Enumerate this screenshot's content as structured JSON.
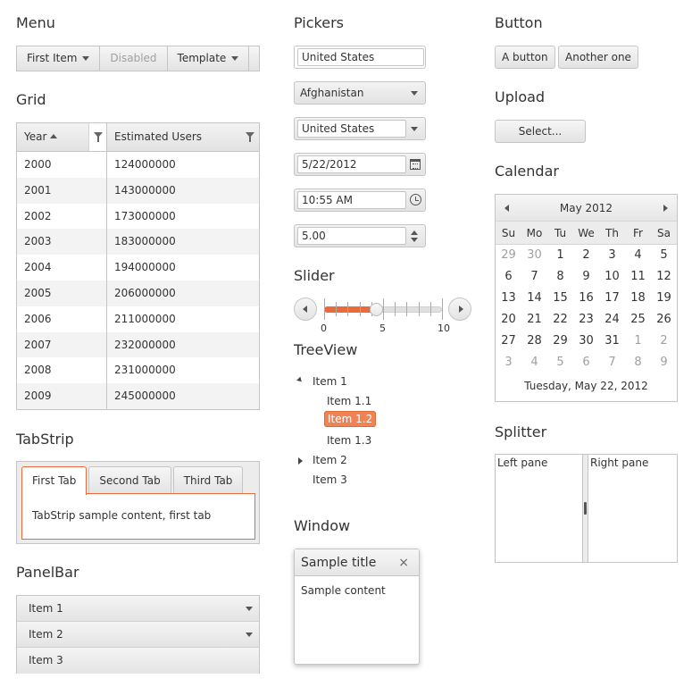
{
  "headings": {
    "menu": "Menu",
    "grid": "Grid",
    "tabstrip": "TabStrip",
    "panelbar": "PanelBar",
    "pickers": "Pickers",
    "slider": "Slider",
    "treeview": "TreeView",
    "window": "Window",
    "button": "Button",
    "upload": "Upload",
    "calendar": "Calendar",
    "splitter": "Splitter"
  },
  "menu": {
    "items": [
      "First Item",
      "Disabled",
      "Template"
    ]
  },
  "grid": {
    "columns": [
      "Year",
      "Estimated Users"
    ],
    "rows": [
      [
        "2000",
        "124000000"
      ],
      [
        "2001",
        "143000000"
      ],
      [
        "2002",
        "173000000"
      ],
      [
        "2003",
        "183000000"
      ],
      [
        "2004",
        "194000000"
      ],
      [
        "2005",
        "206000000"
      ],
      [
        "2006",
        "211000000"
      ],
      [
        "2007",
        "232000000"
      ],
      [
        "2008",
        "231000000"
      ],
      [
        "2009",
        "245000000"
      ]
    ]
  },
  "tabstrip": {
    "tabs": [
      "First Tab",
      "Second Tab",
      "Third Tab"
    ],
    "content": "TabStrip sample content, first tab"
  },
  "panelbar": {
    "items": [
      "Item 1",
      "Item 2",
      "Item 3"
    ]
  },
  "pickers": {
    "autocomplete": "United States",
    "dropdown": "Afghanistan",
    "combobox": "United States",
    "datepicker": "5/22/2012",
    "timepicker": "10:55 AM",
    "numeric": "5.00"
  },
  "slider": {
    "min": 0,
    "mid": 5,
    "max": 10,
    "value": 4.5,
    "labels": [
      "0",
      "5",
      "10"
    ]
  },
  "treeview": {
    "item1": "Item 1",
    "item11": "Item 1.1",
    "item12": "Item 1.2",
    "item13": "Item 1.3",
    "item2": "Item 2",
    "item3": "Item 3"
  },
  "window": {
    "title": "Sample title",
    "close": "×",
    "content": "Sample content"
  },
  "buttons": {
    "a": "A button",
    "b": "Another one"
  },
  "upload": {
    "select": "Select..."
  },
  "calendar": {
    "month": "May 2012",
    "days": [
      "Su",
      "Mo",
      "Tu",
      "We",
      "Th",
      "Fr",
      "Sa"
    ],
    "weeks": [
      [
        "29",
        "30",
        "1",
        "2",
        "3",
        "4",
        "5"
      ],
      [
        "6",
        "7",
        "8",
        "9",
        "10",
        "11",
        "12"
      ],
      [
        "13",
        "14",
        "15",
        "16",
        "17",
        "18",
        "19"
      ],
      [
        "20",
        "21",
        "22",
        "23",
        "24",
        "25",
        "26"
      ],
      [
        "27",
        "28",
        "29",
        "30",
        "31",
        "1",
        "2"
      ],
      [
        "3",
        "4",
        "5",
        "6",
        "7",
        "8",
        "9"
      ]
    ],
    "footer": "Tuesday, May 22, 2012"
  },
  "splitter": {
    "left": "Left pane",
    "right": "Right pane"
  }
}
